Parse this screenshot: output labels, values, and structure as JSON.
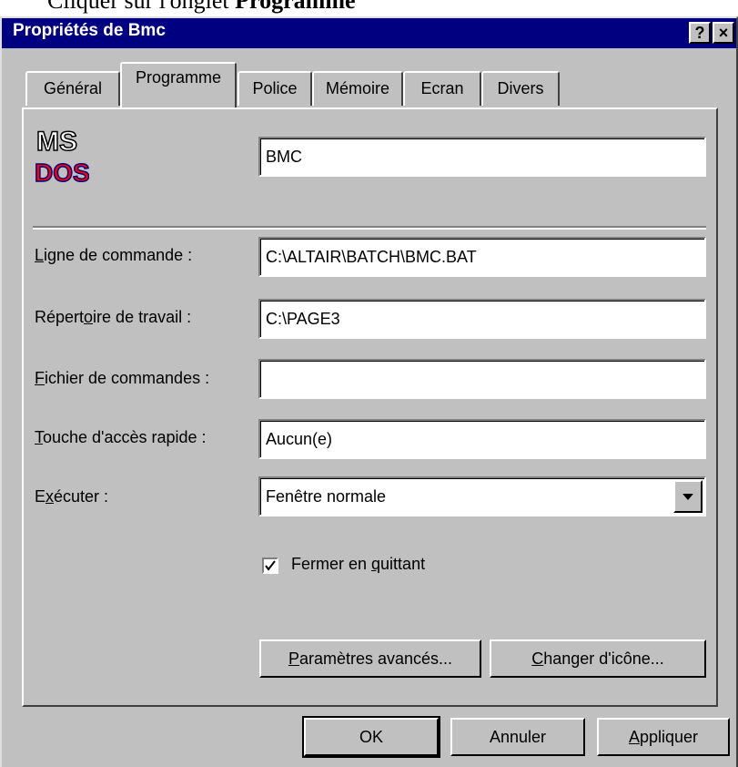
{
  "doc_caption": {
    "prefix": "Cliquer sur l'onglet ",
    "bold": "Programme"
  },
  "window": {
    "title": "Propriétés de Bmc",
    "help_label": "?",
    "close_label": "×"
  },
  "tabs": [
    {
      "label": "Général"
    },
    {
      "label": "Programme"
    },
    {
      "label": "Police"
    },
    {
      "label": "Mémoire"
    },
    {
      "label": "Ecran"
    },
    {
      "label": "Divers"
    }
  ],
  "icon": {
    "name": "ms-dos-icon",
    "text_top": "MS",
    "text_bottom": "DOS"
  },
  "name_field": {
    "value": "BMC"
  },
  "fields": {
    "command_line": {
      "label_u": "L",
      "label_rest": "igne de commande :",
      "value": "C:\\ALTAIR\\BATCH\\BMC.BAT"
    },
    "working_dir": {
      "label_pre": "Répert",
      "label_u": "o",
      "label_rest": "ire de travail :",
      "value": "C:\\PAGE3"
    },
    "batch_file": {
      "label_u": "F",
      "label_rest": "ichier de commandes :",
      "value": ""
    },
    "shortcut": {
      "label_u": "T",
      "label_rest": "ouche d'accès rapide :",
      "value": "Aucun(e)"
    },
    "run": {
      "label_pre": "E",
      "label_u": "x",
      "label_rest": "écuter :",
      "value": "Fenêtre normale"
    }
  },
  "close_on_exit": {
    "checked": true,
    "label_pre": "Fermer en ",
    "label_u": "q",
    "label_rest": "uittant"
  },
  "buttons": {
    "advanced": {
      "label_u": "P",
      "label_rest": "aramètres avancés..."
    },
    "change_icon": {
      "label_u": "C",
      "label_rest": "hanger d'icône..."
    },
    "ok": {
      "label": "OK"
    },
    "cancel": {
      "label": "Annuler"
    },
    "apply": {
      "label_u": "A",
      "label_rest": "ppliquer"
    }
  }
}
